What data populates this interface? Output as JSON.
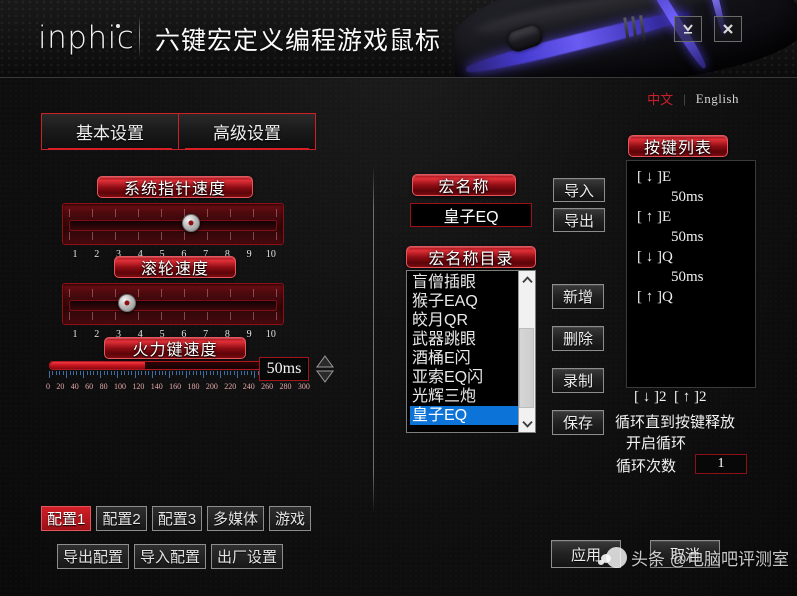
{
  "window": {
    "logo": "inphic",
    "title": "六键宏定义编程游戏鼠标",
    "minimize_icon": "minimize-icon",
    "close_icon": "close-icon"
  },
  "language": {
    "chinese": "中文",
    "separator": "|",
    "english": "English",
    "active": "中文",
    "active_color": "#c8202a"
  },
  "tabs": [
    {
      "label": "基本设置",
      "active": true
    },
    {
      "label": "高级设置",
      "active": false
    }
  ],
  "sliders": {
    "pointer": {
      "label": "系统指针速度",
      "value": 6,
      "min": 1,
      "max": 10,
      "ticks": [
        "1",
        "2",
        "3",
        "4",
        "5",
        "6",
        "7",
        "8",
        "9",
        "10"
      ]
    },
    "wheel": {
      "label": "滚轮速度",
      "value": 3,
      "min": 1,
      "max": 10,
      "ticks": [
        "1",
        "2",
        "3",
        "4",
        "5",
        "6",
        "7",
        "8",
        "9",
        "10"
      ]
    },
    "fire": {
      "label": "火力键速度",
      "value": 50,
      "value_text": "50ms",
      "min": 0,
      "max": 300,
      "ticks": [
        "0",
        "20",
        "40",
        "60",
        "80",
        "100",
        "120",
        "140",
        "160",
        "180",
        "200",
        "220",
        "240",
        "260",
        "280",
        "300"
      ]
    }
  },
  "macro": {
    "name_label": "宏名称",
    "name_value": "皇子EQ",
    "list_label": "宏名称目录",
    "items": [
      "盲僧插眼",
      "猴子EAQ",
      "皎月QR",
      "武器跳眼",
      "酒桶E闪",
      "亚索EQ闪",
      "光辉三炮",
      "皇子EQ"
    ],
    "selected_index": 7,
    "scroll_up_icon": "chevron-up-icon",
    "scroll_down_icon": "chevron-down-icon"
  },
  "io_buttons": [
    {
      "label": "导入"
    },
    {
      "label": "导出"
    }
  ],
  "action_buttons": [
    {
      "label": "新增"
    },
    {
      "label": "删除"
    },
    {
      "label": "录制"
    },
    {
      "label": "保存"
    }
  ],
  "keylist": {
    "title": "按键列表",
    "entries": [
      {
        "text": "[ ↓ ]E",
        "indent": false
      },
      {
        "text": "50ms",
        "indent": true
      },
      {
        "text": "[ ↑ ]E",
        "indent": false
      },
      {
        "text": "50ms",
        "indent": true
      },
      {
        "text": "[ ↓ ]Q",
        "indent": false
      },
      {
        "text": "50ms",
        "indent": true
      },
      {
        "text": "[ ↑ ]Q",
        "indent": false
      }
    ],
    "footer_keys": "[ ↓ ]2  [ ↑ ]2",
    "loop_until_release": "循环直到按键释放",
    "enable_loop": "开启循环",
    "loop_count_label": "循环次数",
    "loop_count_value": "1"
  },
  "profiles": [
    {
      "label": "配置1",
      "active": true
    },
    {
      "label": "配置2",
      "active": false
    },
    {
      "label": "配置3",
      "active": false
    },
    {
      "label": "多媒体",
      "active": false
    },
    {
      "label": "游戏",
      "active": false
    }
  ],
  "config_actions": [
    {
      "label": "导出配置"
    },
    {
      "label": "导入配置"
    },
    {
      "label": "出厂设置"
    }
  ],
  "footer_buttons": [
    {
      "label": "应用"
    },
    {
      "label": "取消"
    }
  ],
  "watermark": {
    "text": "头条 @电脑吧评测室",
    "icon": "toutiao-icon"
  }
}
